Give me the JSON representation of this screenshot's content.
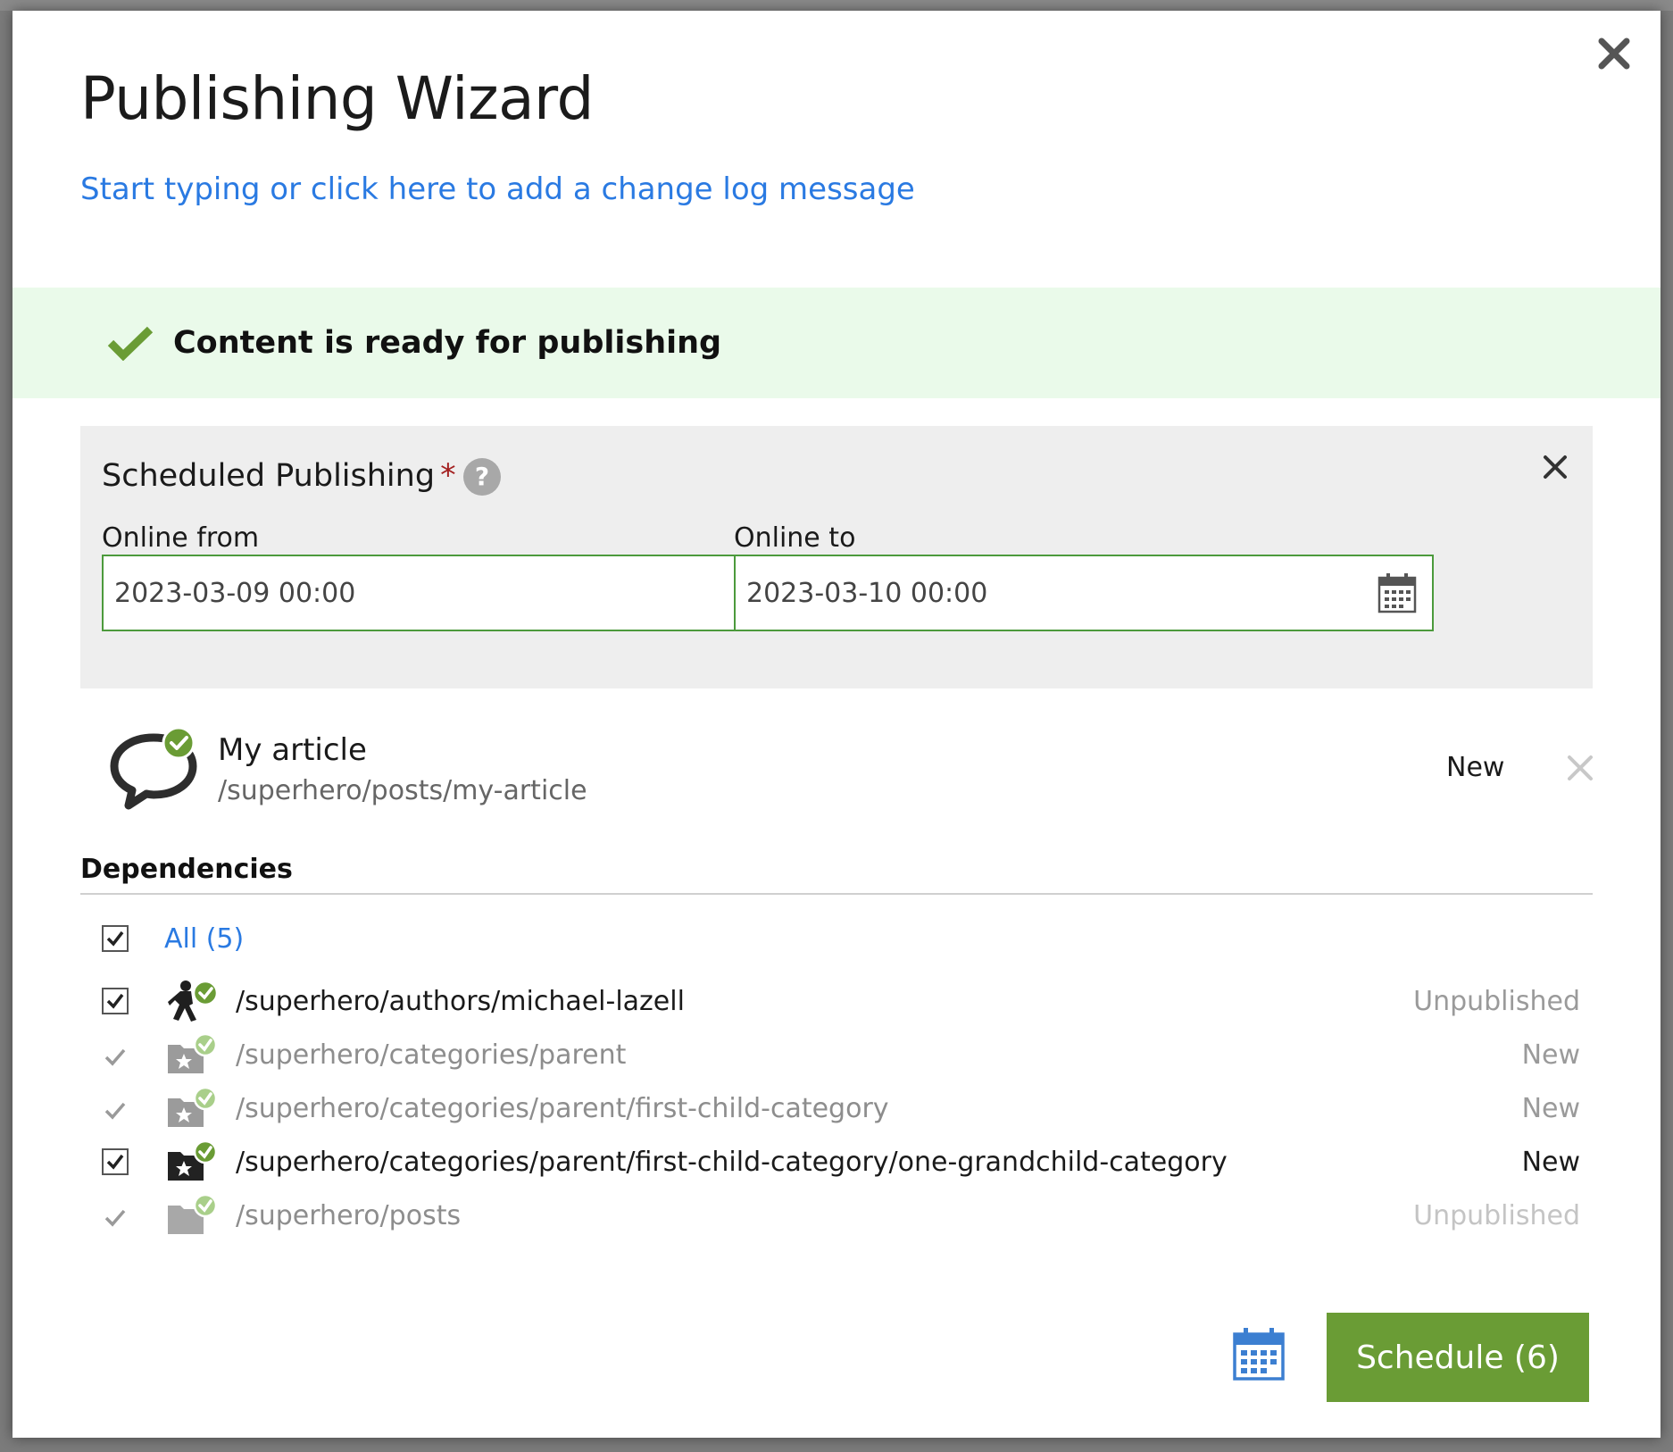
{
  "dialog": {
    "title": "Publishing Wizard",
    "changelog_prompt": "Start typing or click here to add a change log message",
    "close_icon": "close-icon"
  },
  "ready_banner": {
    "text": "Content is ready for publishing",
    "icon": "check-icon",
    "color": "#6a9c35"
  },
  "scheduled": {
    "title": "Scheduled Publishing",
    "required_mark": "*",
    "help_glyph": "?",
    "from_label": "Online from",
    "from_value": "2023-03-09 00:00",
    "to_label": "Online to",
    "to_value": "2023-03-10 00:00"
  },
  "item": {
    "title": "My article",
    "path": "/superhero/posts/my-article",
    "status": "New",
    "icon": "comment-icon"
  },
  "dependencies": {
    "heading": "Dependencies",
    "all_label": "All (5)",
    "rows": [
      {
        "path": "/superhero/authors/michael-lazell",
        "status": "Unpublished",
        "checked": true,
        "icon": "user-icon"
      },
      {
        "path": "/superhero/categories/parent",
        "status": "New",
        "checked": false,
        "icon": "category-folder-icon"
      },
      {
        "path": "/superhero/categories/parent/first-child-category",
        "status": "New",
        "checked": false,
        "icon": "category-folder-icon"
      },
      {
        "path": "/superhero/categories/parent/first-child-category/one-grandchild-category",
        "status": "New",
        "checked": true,
        "icon": "category-folder-icon"
      },
      {
        "path": "/superhero/posts",
        "status": "Unpublished",
        "checked": false,
        "icon": "folder-icon"
      }
    ]
  },
  "footer": {
    "schedule_label": "Schedule (6)",
    "calendar_icon": "calendar-icon",
    "button_color": "#6a9c35",
    "link_color": "#2a7ae2"
  }
}
